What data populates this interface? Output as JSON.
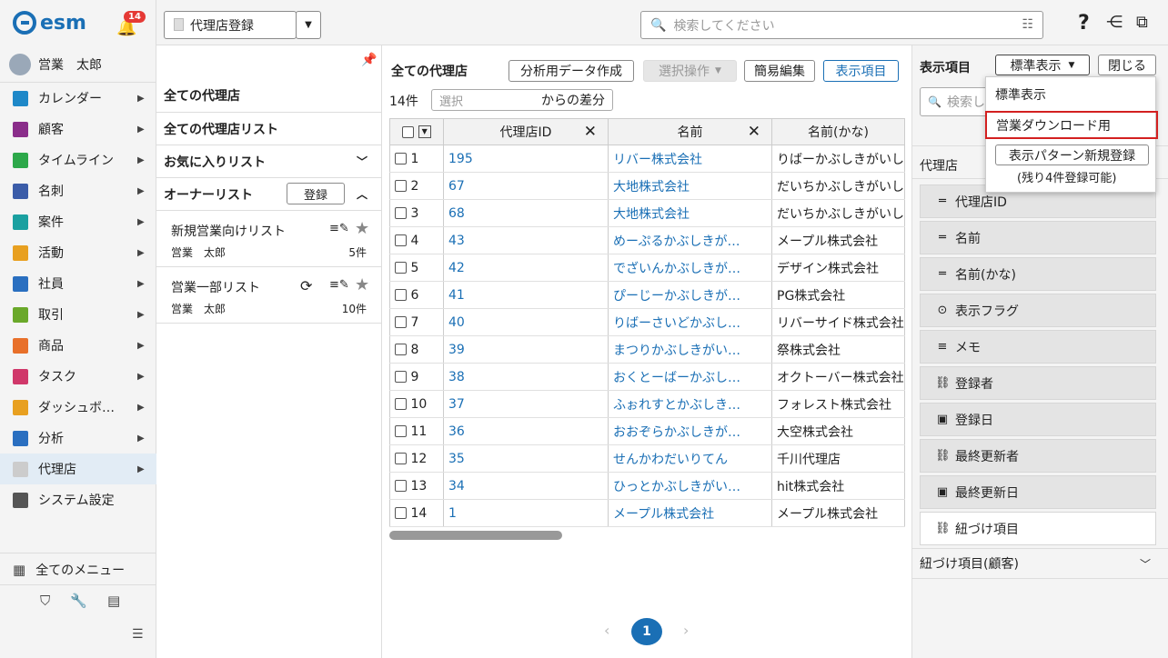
{
  "brand": {
    "logo_text": "esm",
    "notification_count": "14"
  },
  "user": {
    "name": "営業　太郎"
  },
  "nav": {
    "items": [
      {
        "label": "カレンダー",
        "icon": "calendar-icon",
        "color": "#1e88c8"
      },
      {
        "label": "顧客",
        "icon": "building-icon",
        "color": "#8a2d8a"
      },
      {
        "label": "タイムライン",
        "icon": "chat-icon",
        "color": "#2da84a"
      },
      {
        "label": "名刺",
        "icon": "card-icon",
        "color": "#3b5ca8"
      },
      {
        "label": "案件",
        "icon": "folder-icon",
        "color": "#1aa0a0"
      },
      {
        "label": "活動",
        "icon": "clipboard-icon",
        "color": "#e8a020"
      },
      {
        "label": "社員",
        "icon": "person-icon",
        "color": "#2a6fc0"
      },
      {
        "label": "取引",
        "icon": "deal-icon",
        "color": "#6aa82a"
      },
      {
        "label": "商品",
        "icon": "box-icon",
        "color": "#e8702a"
      },
      {
        "label": "タスク",
        "icon": "task-icon",
        "color": "#d0386a"
      },
      {
        "label": "ダッシュボ…",
        "icon": "dashboard-icon",
        "color": "#e8a020"
      },
      {
        "label": "分析",
        "icon": "chart-icon",
        "color": "#2a6fc0"
      },
      {
        "label": "代理店",
        "icon": "document-icon",
        "color": "#cccccc"
      },
      {
        "label": "システム設定",
        "icon": "gear-icon",
        "color": "#555555"
      }
    ],
    "all_menu": "全てのメニュー"
  },
  "topbar": {
    "register_button": "代理店登録",
    "search_placeholder": "検索してください",
    "help": "?"
  },
  "lists": {
    "all": "全ての代理店",
    "all_list": "全ての代理店リスト",
    "favorites": "お気に入りリスト",
    "owner": "オーナーリスト",
    "owner_register": "登録",
    "saved": [
      {
        "name": "新規営業向けリスト",
        "owner": "営業　太郎",
        "count": "5件"
      },
      {
        "name": "営業一部リスト",
        "owner": "営業　太郎",
        "count": "10件"
      }
    ]
  },
  "main": {
    "title": "全ての代理店",
    "analysis_button": "分析用データ作成",
    "select_ops_button": "選択操作",
    "quick_edit_button": "簡易編集",
    "display_items_button": "表示項目",
    "count": "14件",
    "diff_select_placeholder": "選択",
    "diff_label": "からの差分",
    "columns": [
      "代理店ID",
      "名前",
      "名前(かな)"
    ],
    "rows": [
      {
        "n": "1",
        "id": "195",
        "name": "リバー株式会社",
        "kana": "りばーかぶしきがいし"
      },
      {
        "n": "2",
        "id": "67",
        "name": "大地株式会社",
        "kana": "だいちかぶしきがいし"
      },
      {
        "n": "3",
        "id": "68",
        "name": "大地株式会社",
        "kana": "だいちかぶしきがいし"
      },
      {
        "n": "4",
        "id": "43",
        "name": "めーぷるかぶしきが…",
        "kana": "メープル株式会社"
      },
      {
        "n": "5",
        "id": "42",
        "name": "でざいんかぶしきが…",
        "kana": "デザイン株式会社"
      },
      {
        "n": "6",
        "id": "41",
        "name": "ぴーじーかぶしきが…",
        "kana": "PG株式会社"
      },
      {
        "n": "7",
        "id": "40",
        "name": "りばーさいどかぶし…",
        "kana": "リバーサイド株式会社"
      },
      {
        "n": "8",
        "id": "39",
        "name": "まつりかぶしきがい…",
        "kana": "祭株式会社"
      },
      {
        "n": "9",
        "id": "38",
        "name": "おくとーばーかぶし…",
        "kana": "オクトーバー株式会社"
      },
      {
        "n": "10",
        "id": "37",
        "name": "ふぉれすとかぶしき…",
        "kana": "フォレスト株式会社"
      },
      {
        "n": "11",
        "id": "36",
        "name": "おおぞらかぶしきが…",
        "kana": "大空株式会社"
      },
      {
        "n": "12",
        "id": "35",
        "name": "せんかわだいりてん",
        "kana": "千川代理店"
      },
      {
        "n": "13",
        "id": "34",
        "name": "ひっとかぶしきがい…",
        "kana": "hit株式会社"
      },
      {
        "n": "14",
        "id": "1",
        "name": "メープル株式会社",
        "kana": "メープル株式会社"
      }
    ],
    "page": "1"
  },
  "side": {
    "title": "表示項目",
    "pattern_select": "標準表示",
    "close_button": "閉じる",
    "search_placeholder": "検索し",
    "group_label": "代理店",
    "fields": [
      {
        "label": "代理店ID",
        "icon": "text-icon",
        "glyph": "═"
      },
      {
        "label": "名前",
        "icon": "text-icon",
        "glyph": "═"
      },
      {
        "label": "名前(かな)",
        "icon": "text-icon",
        "glyph": "═"
      },
      {
        "label": "表示フラグ",
        "icon": "dropdown-circle-icon",
        "glyph": "⊙"
      },
      {
        "label": "メモ",
        "icon": "lines-icon",
        "glyph": "≡"
      },
      {
        "label": "登録者",
        "icon": "link-icon",
        "glyph": "⛓"
      },
      {
        "label": "登録日",
        "icon": "calendar-icon",
        "glyph": "▣"
      },
      {
        "label": "最終更新者",
        "icon": "link-icon",
        "glyph": "⛓"
      },
      {
        "label": "最終更新日",
        "icon": "calendar-icon",
        "glyph": "▣"
      },
      {
        "label": "紐づけ項目",
        "icon": "link-icon",
        "glyph": "⛓"
      }
    ],
    "related_group": "紐づけ項目(顧客)",
    "dropdown": {
      "options": [
        "標準表示",
        "営業ダウンロード用"
      ],
      "new_pattern_button": "表示パターン新規登録",
      "remaining": "(残り4件登録可能)",
      "highlight_color": "#d32020"
    }
  }
}
